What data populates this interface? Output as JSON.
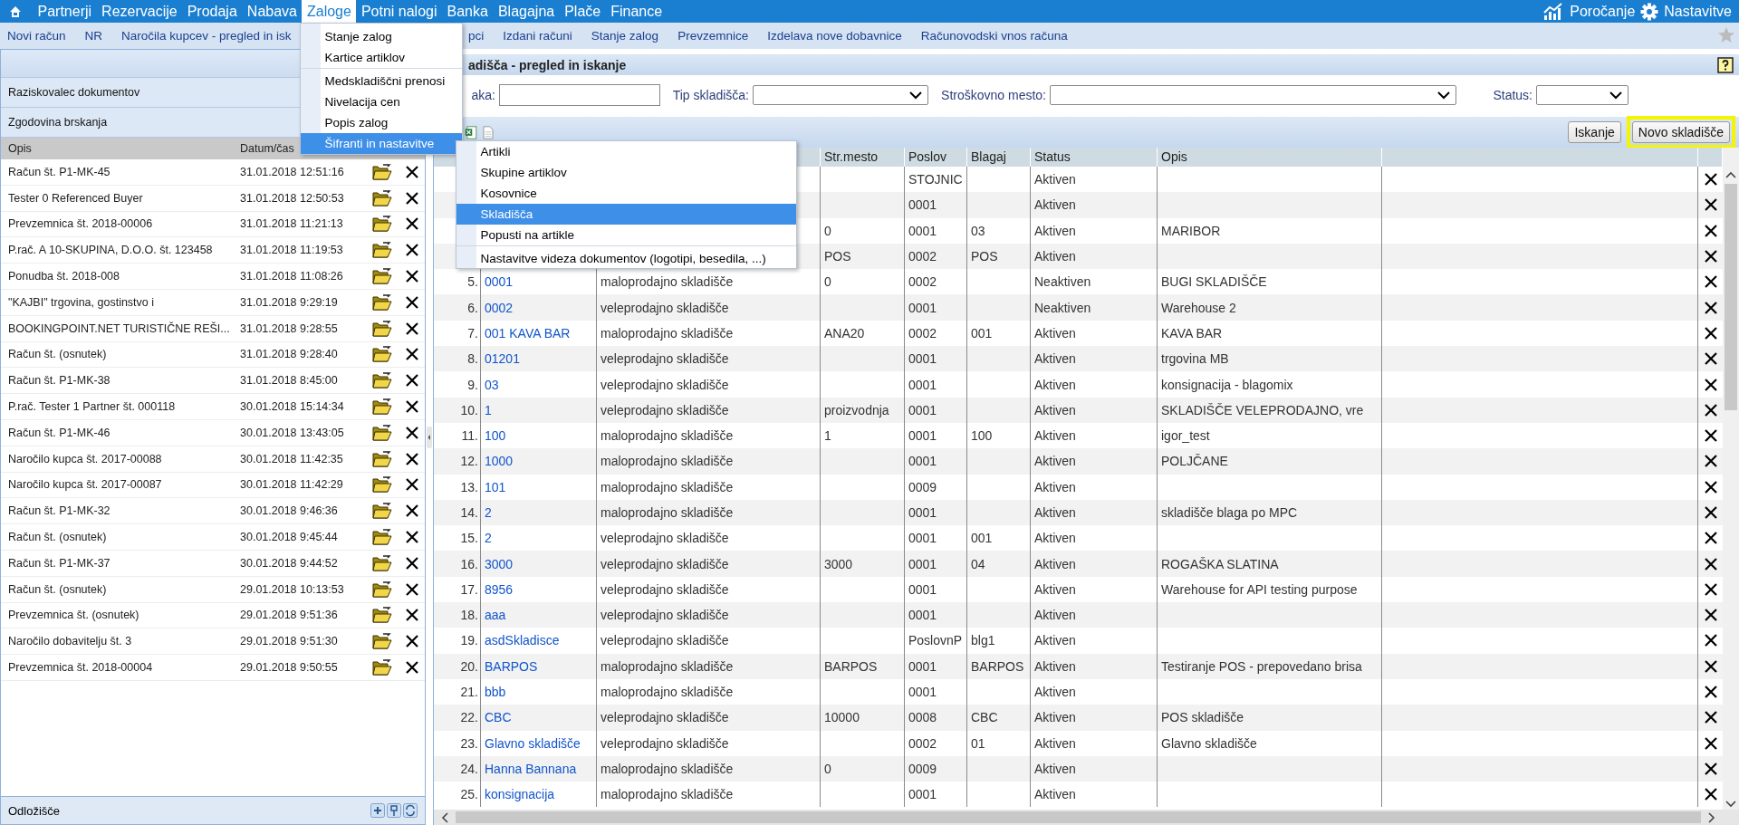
{
  "top_menu": {
    "items": [
      {
        "label": "Partnerji",
        "selected": false
      },
      {
        "label": "Rezervacije",
        "selected": false
      },
      {
        "label": "Prodaja",
        "selected": false
      },
      {
        "label": "Nabava",
        "selected": false
      },
      {
        "label": "Zaloge",
        "selected": true
      },
      {
        "label": "Potni nalogi",
        "selected": false
      },
      {
        "label": "Banka",
        "selected": false
      },
      {
        "label": "Blagajna",
        "selected": false
      },
      {
        "label": "Plače",
        "selected": false
      },
      {
        "label": "Finance",
        "selected": false
      }
    ],
    "right": [
      {
        "label": "Poročanje",
        "kind": "chart"
      },
      {
        "label": "Nastavitve",
        "kind": "gear"
      }
    ]
  },
  "dropdown": {
    "items": [
      {
        "label": "Stanje zalog",
        "selected": false,
        "separator_before": false
      },
      {
        "label": "Kartice artiklov",
        "selected": false,
        "separator_before": false
      },
      {
        "label": "Medskladiščni prenosi",
        "selected": false,
        "separator_before": true
      },
      {
        "label": "Nivelacija cen",
        "selected": false,
        "separator_before": false
      },
      {
        "label": "Popis zalog",
        "selected": false,
        "separator_before": false
      },
      {
        "label": "Šifranti in nastavitve",
        "selected": true,
        "separator_before": false
      }
    ]
  },
  "submenu": {
    "items": [
      {
        "label": "Artikli",
        "selected": false,
        "separator_before": false
      },
      {
        "label": "Skupine artiklov",
        "selected": false,
        "separator_before": false
      },
      {
        "label": "Kosovnice",
        "selected": false,
        "separator_before": false
      },
      {
        "label": "Skladišča",
        "selected": true,
        "separator_before": false
      },
      {
        "label": "Popusti na artikle",
        "selected": false,
        "separator_before": false
      },
      {
        "label": "Nastavitve videza dokumentov (logotipi, besedila, ...)",
        "selected": false,
        "separator_before": true
      }
    ]
  },
  "toolbar": {
    "items_before_menu": [
      "Novi račun",
      "NR",
      "Naročila kupcev - pregled in isk"
    ],
    "items_after_menu": [
      "pci",
      "Izdani računi",
      "Stanje zalog",
      "Prevzemnice",
      "Izdelava nove dobavnice",
      "Računovodski vnos računa"
    ]
  },
  "left_panel": {
    "sections": [
      "Raziskovalec dokumentov",
      "Zgodovina brskanja"
    ],
    "columns": [
      "Opis",
      "Datum/čas"
    ],
    "rows": [
      {
        "opis": "Račun št. P1-MK-45",
        "datetime": "31.01.2018 12:51:16"
      },
      {
        "opis": "Tester 0 Referenced Buyer",
        "datetime": "31.01.2018 12:50:53"
      },
      {
        "opis": "Prevzemnica št. 2018-00006",
        "datetime": "31.01.2018 11:21:13"
      },
      {
        "opis": "P.rač. A 10-SKUPINA, D.O.O. št. 123458",
        "datetime": "31.01.2018 11:19:53"
      },
      {
        "opis": "Ponudba št. 2018-008",
        "datetime": "31.01.2018 11:08:26"
      },
      {
        "opis": "\"KAJBI\" trgovina, gostinstvo i",
        "datetime": "31.01.2018 9:29:19"
      },
      {
        "opis": "BOOKINGPOINT.NET TURISTIČNE REŠI...",
        "datetime": "31.01.2018 9:28:55"
      },
      {
        "opis": "Račun št. (osnutek)",
        "datetime": "31.01.2018 9:28:40"
      },
      {
        "opis": "Račun št. P1-MK-38",
        "datetime": "31.01.2018 8:45:00"
      },
      {
        "opis": "P.rač. Tester 1 Partner št. 000118",
        "datetime": "30.01.2018 15:14:34"
      },
      {
        "opis": "Račun št. P1-MK-46",
        "datetime": "30.01.2018 13:43:05"
      },
      {
        "opis": "Naročilo kupca št. 2017-00088",
        "datetime": "30.01.2018 11:42:35"
      },
      {
        "opis": "Naročilo kupca št. 2017-00087",
        "datetime": "30.01.2018 11:42:29"
      },
      {
        "opis": "Račun št. P1-MK-32",
        "datetime": "30.01.2018 9:46:36"
      },
      {
        "opis": "Račun št. (osnutek)",
        "datetime": "30.01.2018 9:45:44"
      },
      {
        "opis": "Račun št. P1-MK-37",
        "datetime": "30.01.2018 9:44:52"
      },
      {
        "opis": "Račun št. (osnutek)",
        "datetime": "29.01.2018 10:13:53"
      },
      {
        "opis": "Prevzemnica št. (osnutek)",
        "datetime": "29.01.2018 9:51:36"
      },
      {
        "opis": "Naročilo dobavitelju št. 3",
        "datetime": "29.01.2018 9:51:30"
      },
      {
        "opis": "Prevzemnica št. 2018-00004",
        "datetime": "29.01.2018 9:50:55"
      }
    ],
    "footer": "Odložišče"
  },
  "main": {
    "title": "adišča - pregled in iskanje",
    "filters": {
      "code_label": "aka:",
      "type_label": "Tip skladišča:",
      "cost_center_label": "Stroškovno mesto:",
      "status_label": "Status:"
    },
    "buttons": [
      "Iskanje",
      "Novo skladišče"
    ],
    "table": {
      "columns": [
        "Str.mesto",
        "Poslov",
        "Blagaj",
        "Status",
        "Opis"
      ],
      "rows": [
        {
          "business_unit": "STOJNIC",
          "status": "Aktiven"
        },
        {
          "business_unit": "0001",
          "status": "Aktiven"
        },
        {
          "cost_center": "0",
          "business_unit": "0001",
          "till": "03",
          "status": "Aktiven",
          "description": "MARIBOR"
        },
        {
          "cost_center": "POS",
          "business_unit": "0002",
          "till": "POS",
          "status": "Aktiven"
        },
        {
          "number": "5.",
          "code": "0001",
          "type": "maloprodajno skladišče",
          "cost_center": "0",
          "business_unit": "0002",
          "status": "Neaktiven",
          "description": "BUGI SKLADIŠČE"
        },
        {
          "number": "6.",
          "code": "0002",
          "type": "veleprodajno skladišče",
          "business_unit": "0001",
          "status": "Neaktiven",
          "description": "Warehouse 2"
        },
        {
          "number": "7.",
          "code": "001 KAVA BAR",
          "type": "maloprodajno skladišče",
          "cost_center": "ANA20",
          "business_unit": "0002",
          "till": "001",
          "status": "Aktiven",
          "description": "KAVA BAR"
        },
        {
          "number": "8.",
          "code": "01201",
          "type": "veleprodajno skladišče",
          "business_unit": "0001",
          "status": "Aktiven",
          "description": "trgovina MB"
        },
        {
          "number": "9.",
          "code": "03",
          "type": "veleprodajno skladišče",
          "business_unit": "0001",
          "status": "Aktiven",
          "description": "konsignacija - blagomix"
        },
        {
          "number": "10.",
          "code": "1",
          "type": "veleprodajno skladišče",
          "cost_center": "proizvodnja",
          "business_unit": "0001",
          "status": "Aktiven",
          "description": "SKLADIŠČE VELEPRODAJNO, vre"
        },
        {
          "number": "11.",
          "code": "100",
          "type": "maloprodajno skladišče",
          "cost_center": "1",
          "business_unit": "0001",
          "till": "100",
          "status": "Aktiven",
          "description": "igor_test"
        },
        {
          "number": "12.",
          "code": "1000",
          "type": "maloprodajno skladišče",
          "business_unit": "0001",
          "status": "Aktiven",
          "description": "POLJČANE"
        },
        {
          "number": "13.",
          "code": "101",
          "type": "maloprodajno skladišče",
          "business_unit": "0009",
          "status": "Aktiven"
        },
        {
          "number": "14.",
          "code": "2",
          "type": "maloprodajno skladišče",
          "business_unit": "0001",
          "status": "Aktiven",
          "description": "skladišče blaga po MPC"
        },
        {
          "number": "15.",
          "code": "2",
          "type": "veleprodajno skladišče",
          "business_unit": "0001",
          "till": "001",
          "status": "Aktiven"
        },
        {
          "number": "16.",
          "code": "3000",
          "type": "veleprodajno skladišče",
          "cost_center": "3000",
          "business_unit": "0001",
          "till": "04",
          "status": "Aktiven",
          "description": "ROGAŠKA SLATINA"
        },
        {
          "number": "17.",
          "code": "8956",
          "type": "veleprodajno skladišče",
          "business_unit": "0001",
          "status": "Aktiven",
          "description": "Warehouse for API testing purpose"
        },
        {
          "number": "18.",
          "code": "aaa",
          "type": "veleprodajno skladišče",
          "business_unit": "0001",
          "status": "Aktiven"
        },
        {
          "number": "19.",
          "code": "asdSkladisce",
          "type": "veleprodajno skladišče",
          "business_unit": "PoslovnP",
          "till": "blg1",
          "status": "Aktiven"
        },
        {
          "number": "20.",
          "code": "BARPOS",
          "type": "maloprodajno skladišče",
          "cost_center": "BARPOS",
          "business_unit": "0001",
          "till": "BARPOS",
          "status": "Aktiven",
          "description": "Testiranje POS - prepovedano brisa"
        },
        {
          "number": "21.",
          "code": "bbb",
          "type": "maloprodajno skladišče",
          "business_unit": "0001",
          "status": "Aktiven"
        },
        {
          "number": "22.",
          "code": "CBC",
          "type": "veleprodajno skladišče",
          "cost_center": "10000",
          "business_unit": "0008",
          "till": "CBC",
          "status": "Aktiven",
          "description": "POS skladišče"
        },
        {
          "number": "23.",
          "code": "Glavno skladišče",
          "type": "veleprodajno skladišče",
          "business_unit": "0002",
          "till": "01",
          "status": "Aktiven",
          "description": "Glavno skladišče"
        },
        {
          "number": "24.",
          "code": "Hanna Bannana",
          "type": "maloprodajno skladišče",
          "cost_center": "0",
          "business_unit": "0009",
          "status": "Aktiven"
        },
        {
          "number": "25.",
          "code": "konsignacija",
          "type": "maloprodajno skladišče",
          "business_unit": "0001",
          "status": "Aktiven"
        }
      ]
    }
  }
}
